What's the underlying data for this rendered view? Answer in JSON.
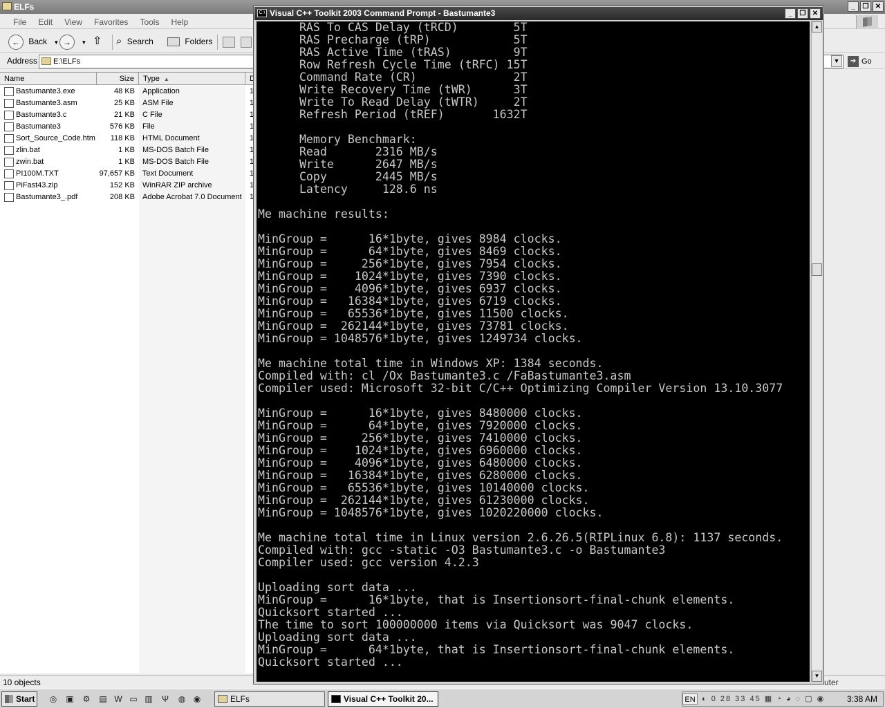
{
  "explorer": {
    "title": "ELFs",
    "menu": [
      "File",
      "Edit",
      "View",
      "Favorites",
      "Tools",
      "Help"
    ],
    "toolbar": {
      "back": "Back",
      "search": "Search",
      "folders": "Folders"
    },
    "address_label": "Address",
    "address_value": "E:\\ELFs",
    "go": "Go",
    "columns": {
      "name": "Name",
      "size": "Size",
      "type": "Type",
      "date": "D"
    },
    "files": [
      {
        "name": "Bastumante3.exe",
        "size": "48 KB",
        "type": "Application",
        "date": "1"
      },
      {
        "name": "Bastumante3.asm",
        "size": "25 KB",
        "type": "ASM File",
        "date": "1"
      },
      {
        "name": "Bastumante3.c",
        "size": "21 KB",
        "type": "C File",
        "date": "1"
      },
      {
        "name": "Bastumante3",
        "size": "576 KB",
        "type": "File",
        "date": "1"
      },
      {
        "name": "Sort_Source_Code.htm",
        "size": "118 KB",
        "type": "HTML Document",
        "date": "1"
      },
      {
        "name": "zlin.bat",
        "size": "1 KB",
        "type": "MS-DOS Batch File",
        "date": "1"
      },
      {
        "name": "zwin.bat",
        "size": "1 KB",
        "type": "MS-DOS Batch File",
        "date": "1"
      },
      {
        "name": "PI100M.TXT",
        "size": "97,657 KB",
        "type": "Text Document",
        "date": "1"
      },
      {
        "name": "PiFast43.zip",
        "size": "152 KB",
        "type": "WinRAR ZIP archive",
        "date": "1"
      },
      {
        "name": "Bastumante3_.pdf",
        "size": "208 KB",
        "type": "Adobe Acrobat 7.0 Document",
        "date": "1"
      }
    ],
    "status_count": "10 objects",
    "status_right": "uter"
  },
  "console": {
    "title": "Visual C++ Toolkit 2003 Command Prompt - Bastumante3",
    "lines": [
      "      RAS To CAS Delay (tRCD)        5T",
      "      RAS Precharge (tRP)            5T",
      "      RAS Active Time (tRAS)         9T",
      "      Row Refresh Cycle Time (tRFC) 15T",
      "      Command Rate (CR)              2T",
      "      Write Recovery Time (tWR)      3T",
      "      Write To Read Delay (tWTR)     2T",
      "      Refresh Period (tREF)       1632T",
      "",
      "      Memory Benchmark:",
      "      Read       2316 MB/s",
      "      Write      2647 MB/s",
      "      Copy       2445 MB/s",
      "      Latency     128.6 ns",
      "",
      "Me machine results:",
      "",
      "MinGroup =      16*1byte, gives 8984 clocks.",
      "MinGroup =      64*1byte, gives 8469 clocks.",
      "MinGroup =     256*1byte, gives 7954 clocks.",
      "MinGroup =    1024*1byte, gives 7390 clocks.",
      "MinGroup =    4096*1byte, gives 6937 clocks.",
      "MinGroup =   16384*1byte, gives 6719 clocks.",
      "MinGroup =   65536*1byte, gives 11500 clocks.",
      "MinGroup =  262144*1byte, gives 73781 clocks.",
      "MinGroup = 1048576*1byte, gives 1249734 clocks.",
      "",
      "Me machine total time in Windows XP: 1384 seconds.",
      "Compiled with: cl /Ox Bastumante3.c /FaBastumante3.asm",
      "Compiler used: Microsoft 32-bit C/C++ Optimizing Compiler Version 13.10.3077",
      "",
      "MinGroup =      16*1byte, gives 8480000 clocks.",
      "MinGroup =      64*1byte, gives 7920000 clocks.",
      "MinGroup =     256*1byte, gives 7410000 clocks.",
      "MinGroup =    1024*1byte, gives 6960000 clocks.",
      "MinGroup =    4096*1byte, gives 6480000 clocks.",
      "MinGroup =   16384*1byte, gives 6280000 clocks.",
      "MinGroup =   65536*1byte, gives 10140000 clocks.",
      "MinGroup =  262144*1byte, gives 61230000 clocks.",
      "MinGroup = 1048576*1byte, gives 1020220000 clocks.",
      "",
      "Me machine total time in Linux version 2.6.26.5(RIPLinux 6.8): 1137 seconds.",
      "Compiled with: gcc -static -O3 Bastumante3.c -o Bastumante3",
      "Compiler used: gcc version 4.2.3",
      "",
      "Uploading sort data ...",
      "MinGroup =      16*1byte, that is Insertionsort-final-chunk elements.",
      "Quicksort started ...",
      "The time to sort 100000000 items via Quicksort was 9047 clocks.",
      "Uploading sort data ...",
      "MinGroup =      64*1byte, that is Insertionsort-final-chunk elements.",
      "Quicksort started ..."
    ]
  },
  "taskbar": {
    "start": "Start",
    "tasks": [
      {
        "label": "ELFs",
        "active": false
      },
      {
        "label": "Visual C++ Toolkit 20...",
        "active": true
      }
    ],
    "lang": "EN",
    "tray_text": "0 28 33 45",
    "clock": "3:38 AM"
  }
}
